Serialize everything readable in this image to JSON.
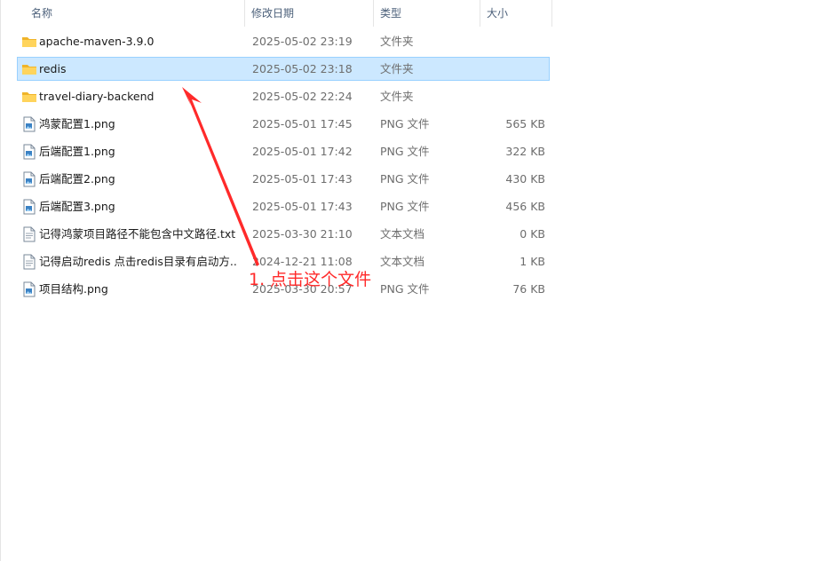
{
  "columns": {
    "name": "名称",
    "date": "修改日期",
    "type": "类型",
    "size": "大小",
    "sort_indicator": "^"
  },
  "files": [
    {
      "name": "apache-maven-3.9.0",
      "date": "2025-05-02 23:19",
      "type": "文件夹",
      "size": "",
      "icon": "folder-icon",
      "selected": false
    },
    {
      "name": "redis",
      "date": "2025-05-02 23:18",
      "type": "文件夹",
      "size": "",
      "icon": "folder-icon",
      "selected": true
    },
    {
      "name": "travel-diary-backend",
      "date": "2025-05-02 22:24",
      "type": "文件夹",
      "size": "",
      "icon": "folder-icon",
      "selected": false
    },
    {
      "name": "鸿蒙配置1.png",
      "date": "2025-05-01 17:45",
      "type": "PNG 文件",
      "size": "565 KB",
      "icon": "png-file-icon",
      "selected": false
    },
    {
      "name": "后端配置1.png",
      "date": "2025-05-01 17:42",
      "type": "PNG 文件",
      "size": "322 KB",
      "icon": "png-file-icon",
      "selected": false
    },
    {
      "name": "后端配置2.png",
      "date": "2025-05-01 17:43",
      "type": "PNG 文件",
      "size": "430 KB",
      "icon": "png-file-icon",
      "selected": false
    },
    {
      "name": "后端配置3.png",
      "date": "2025-05-01 17:43",
      "type": "PNG 文件",
      "size": "456 KB",
      "icon": "png-file-icon",
      "selected": false
    },
    {
      "name": "记得鸿蒙项目路径不能包含中文路径.txt",
      "date": "2025-03-30 21:10",
      "type": "文本文档",
      "size": "0 KB",
      "icon": "text-file-icon",
      "selected": false
    },
    {
      "name": "记得启动redis 点击redis目录有启动方...",
      "date": "2024-12-21 11:08",
      "type": "文本文档",
      "size": "1 KB",
      "icon": "text-file-icon",
      "selected": false
    },
    {
      "name": "项目结构.png",
      "date": "2025-03-30 20:57",
      "type": "PNG 文件",
      "size": "76 KB",
      "icon": "png-file-icon",
      "selected": false
    }
  ],
  "annotation": {
    "text": "1. 点击这个文件",
    "color": "#ff2a2a"
  },
  "colors": {
    "selection_bg": "#cce8ff",
    "selection_border": "#99d1ff",
    "folder": "#ffc83d",
    "header_text": "#4c607a"
  }
}
